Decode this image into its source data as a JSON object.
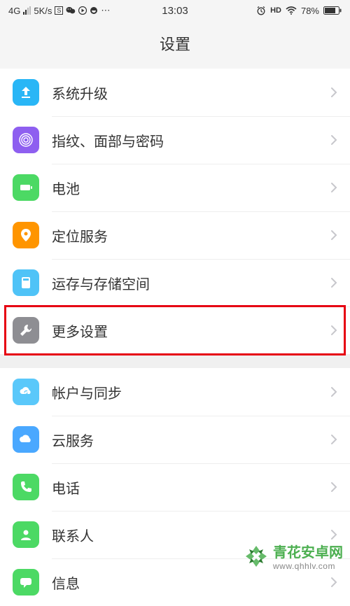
{
  "status": {
    "network": "4G",
    "speed": "5K/s",
    "s_indicator": "S",
    "time": "13:03",
    "hd": "HD",
    "battery_pct": "78%"
  },
  "title": "设置",
  "groups": [
    {
      "items": [
        {
          "id": "system-upgrade",
          "label": "系统升级",
          "icon": "upgrade",
          "icon_class": "ic-blue1"
        },
        {
          "id": "biometrics",
          "label": "指纹、面部与密码",
          "icon": "fingerprint",
          "icon_class": "ic-purple"
        },
        {
          "id": "battery",
          "label": "电池",
          "icon": "battery",
          "icon_class": "ic-green1"
        },
        {
          "id": "location",
          "label": "定位服务",
          "icon": "location",
          "icon_class": "ic-orange"
        },
        {
          "id": "storage",
          "label": "运存与存储空间",
          "icon": "storage",
          "icon_class": "ic-teal"
        },
        {
          "id": "more-settings",
          "label": "更多设置",
          "icon": "wrench",
          "icon_class": "ic-grey",
          "highlight": true
        }
      ]
    },
    {
      "items": [
        {
          "id": "account-sync",
          "label": "帐户与同步",
          "icon": "cloud-sync",
          "icon_class": "ic-aqua"
        },
        {
          "id": "cloud",
          "label": "云服务",
          "icon": "cloud",
          "icon_class": "ic-blue2"
        },
        {
          "id": "phone",
          "label": "电话",
          "icon": "phone",
          "icon_class": "ic-green2"
        },
        {
          "id": "contacts",
          "label": "联系人",
          "icon": "contact",
          "icon_class": "ic-green3"
        },
        {
          "id": "messages",
          "label": "信息",
          "icon": "message",
          "icon_class": "ic-green4"
        }
      ]
    }
  ],
  "watermark": {
    "brand": "青花安卓网",
    "url": "www.qhhlv.com"
  }
}
